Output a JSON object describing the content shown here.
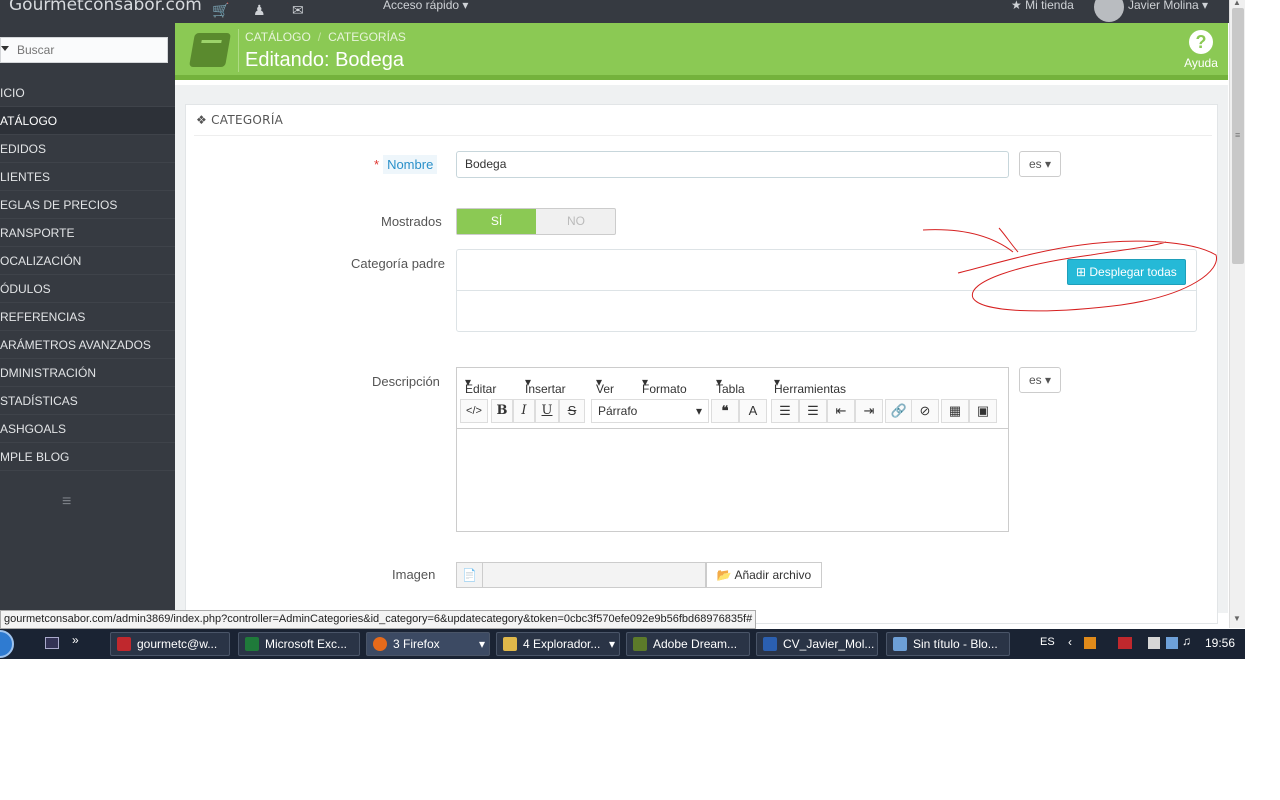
{
  "topbar": {
    "brand": "Gourmetconsabor.com",
    "icons": [
      "cart-icon",
      "user-icon",
      "envelope-icon"
    ],
    "quick_access": "Acceso rápido",
    "my_store": "Mi tienda",
    "user": "Javier Molina"
  },
  "sidebar": {
    "search_placeholder": "Buscar",
    "items": [
      {
        "label": "ICIO"
      },
      {
        "label": "ATÁLOGO"
      },
      {
        "label": "EDIDOS"
      },
      {
        "label": "LIENTES"
      },
      {
        "label": "EGLAS DE PRECIOS"
      },
      {
        "label": "RANSPORTE"
      },
      {
        "label": "OCALIZACIÓN"
      },
      {
        "label": "ÓDULOS"
      },
      {
        "label": "REFERENCIAS"
      },
      {
        "label": "ARÁMETROS AVANZADOS"
      },
      {
        "label": "DMINISTRACIÓN"
      },
      {
        "label": "STADÍSTICAS"
      },
      {
        "label": "ASHGOALS"
      },
      {
        "label": "MPLE BLOG"
      }
    ]
  },
  "header": {
    "breadcrumb": [
      "CATÁLOGO",
      "CATEGORÍAS"
    ],
    "title": "Editando: Bodega",
    "help": "Ayuda"
  },
  "panel": {
    "title": "CATEGORÍA",
    "name_label": "Nombre",
    "name_value": "Bodega",
    "lang": "es",
    "shown_label": "Mostrados",
    "toggle_on": "SÍ",
    "toggle_off": "NO",
    "parent_label": "Categoría padre",
    "expand_all": "Desplegar todas",
    "desc_label": "Descripción",
    "editor": {
      "menus": [
        "Editar",
        "Insertar",
        "Ver",
        "Formato",
        "Tabla",
        "Herramientas"
      ],
      "format": "Párrafo"
    },
    "image_label": "Imagen",
    "add_file": "Añadir archivo"
  },
  "status_url": "gourmetconsabor.com/admin3869/index.php?controller=AdminCategories&id_category=6&updatecategory&token=0cbc3f570efe092e9b56fbd68976835f#",
  "taskbar": {
    "items": [
      {
        "label": "gourmetc@w...",
        "color": "#c0282d"
      },
      {
        "label": "Microsoft Exc...",
        "color": "#1f7a3a"
      },
      {
        "label": "3 Firefox",
        "color": "#e66a1a"
      },
      {
        "label": "4 Explorador...",
        "color": "#e0b84a"
      },
      {
        "label": "Adobe Dream...",
        "color": "#5c7a2a"
      },
      {
        "label": "CV_Javier_Mol...",
        "color": "#2b5fb0"
      },
      {
        "label": "Sin título - Blo...",
        "color": "#6ea0d8"
      }
    ],
    "lang": "ES",
    "clock": "19:56"
  },
  "colors": {
    "green": "#8bc954",
    "dark": "#363a41",
    "blue": "#25b9d7"
  }
}
